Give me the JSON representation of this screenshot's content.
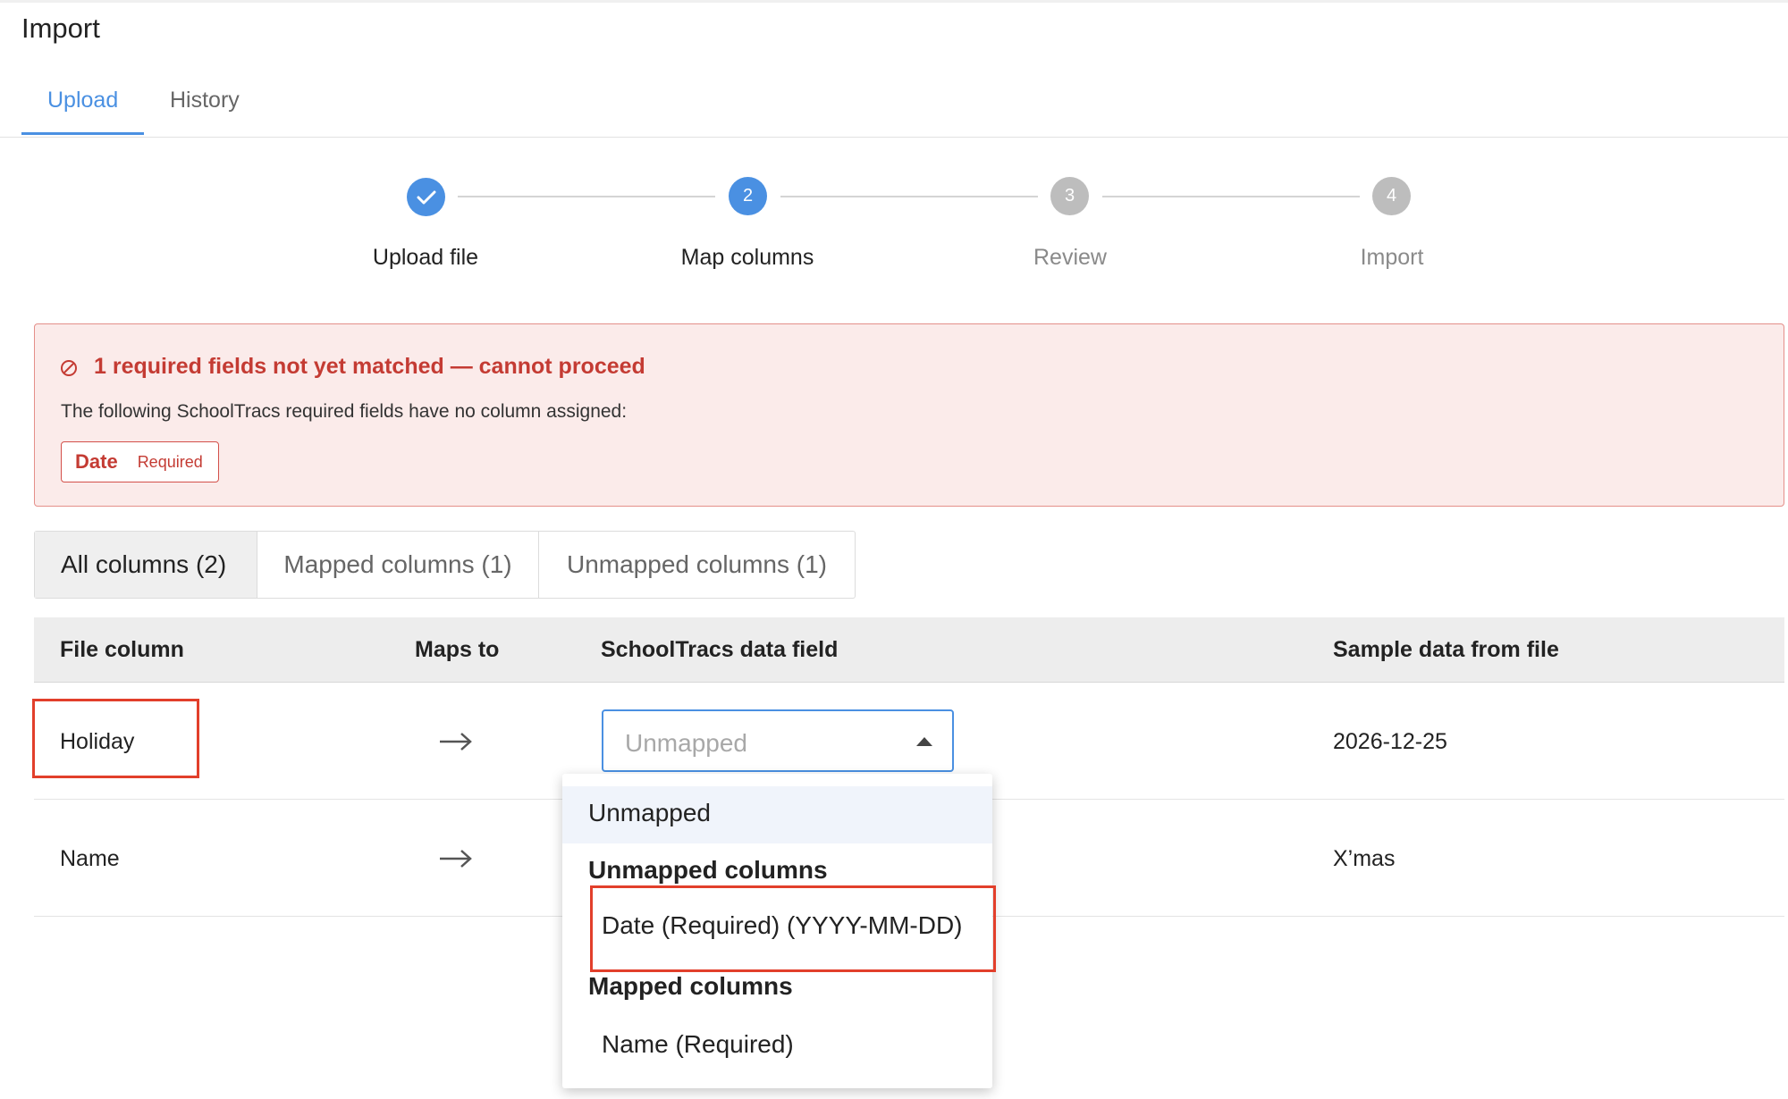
{
  "page": {
    "title": "Import"
  },
  "tabs": [
    {
      "label": "Upload",
      "active": true
    },
    {
      "label": "History",
      "active": false
    }
  ],
  "stepper": {
    "steps": [
      {
        "number": "✓",
        "label": "Upload file",
        "state": "done"
      },
      {
        "number": "2",
        "label": "Map columns",
        "state": "active"
      },
      {
        "number": "3",
        "label": "Review",
        "state": "pending"
      },
      {
        "number": "4",
        "label": "Import",
        "state": "pending"
      }
    ]
  },
  "alert": {
    "title": "1 required fields not yet matched — cannot proceed",
    "message": "The following SchoolTracs required fields have no column assigned:",
    "missing_field": {
      "name": "Date",
      "tag": "Required"
    },
    "icon": "blocked-icon",
    "color": "#c43b33"
  },
  "filters": [
    {
      "label": "All columns (2)",
      "active": true
    },
    {
      "label": "Mapped columns (1)",
      "active": false
    },
    {
      "label": "Unmapped columns (1)",
      "active": false
    }
  ],
  "table": {
    "headers": [
      "File column",
      "Maps to",
      "SchoolTracs data field",
      "Sample data from file"
    ],
    "rows": [
      {
        "file_column": "Holiday",
        "data_field": "Unmapped",
        "sample": "2026-12-25"
      },
      {
        "file_column": "Name",
        "data_field": "",
        "sample": "X’mas"
      }
    ]
  },
  "dropdown": {
    "selected": "Unmapped",
    "groups": [
      {
        "label": "Unmapped columns",
        "options": [
          "Date (Required) (YYYY-MM-DD)"
        ]
      },
      {
        "label": "Mapped columns",
        "options": [
          "Name (Required)"
        ]
      }
    ]
  },
  "colors": {
    "accent": "#4a90e2",
    "error": "#c43b33",
    "highlight": "#e23f2b"
  }
}
